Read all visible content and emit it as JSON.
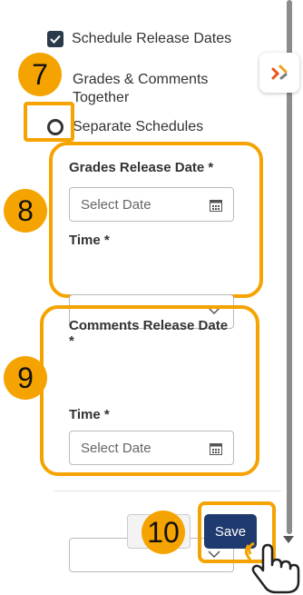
{
  "options": {
    "schedule_release_label": "Schedule Release Dates",
    "together_label_line1": "Grades & Comments",
    "together_label_line2": "Together",
    "separate_label": "Separate Schedules"
  },
  "grades_section": {
    "date_label": "Grades Release Date *",
    "date_placeholder": "Select Date",
    "time_label": "Time *"
  },
  "comments_section": {
    "date_label_line1": "Comments Release Date",
    "date_label_line2": "*",
    "date_placeholder": "Select Date",
    "time_label": "Time *"
  },
  "footer": {
    "save_label": "Save"
  },
  "callouts": {
    "step7": "7",
    "step8": "8",
    "step9": "9",
    "step10": "10"
  },
  "colors": {
    "highlight": "#f5a300",
    "save_button": "#1f3a6e",
    "checkbox": "#2b3a4a"
  }
}
